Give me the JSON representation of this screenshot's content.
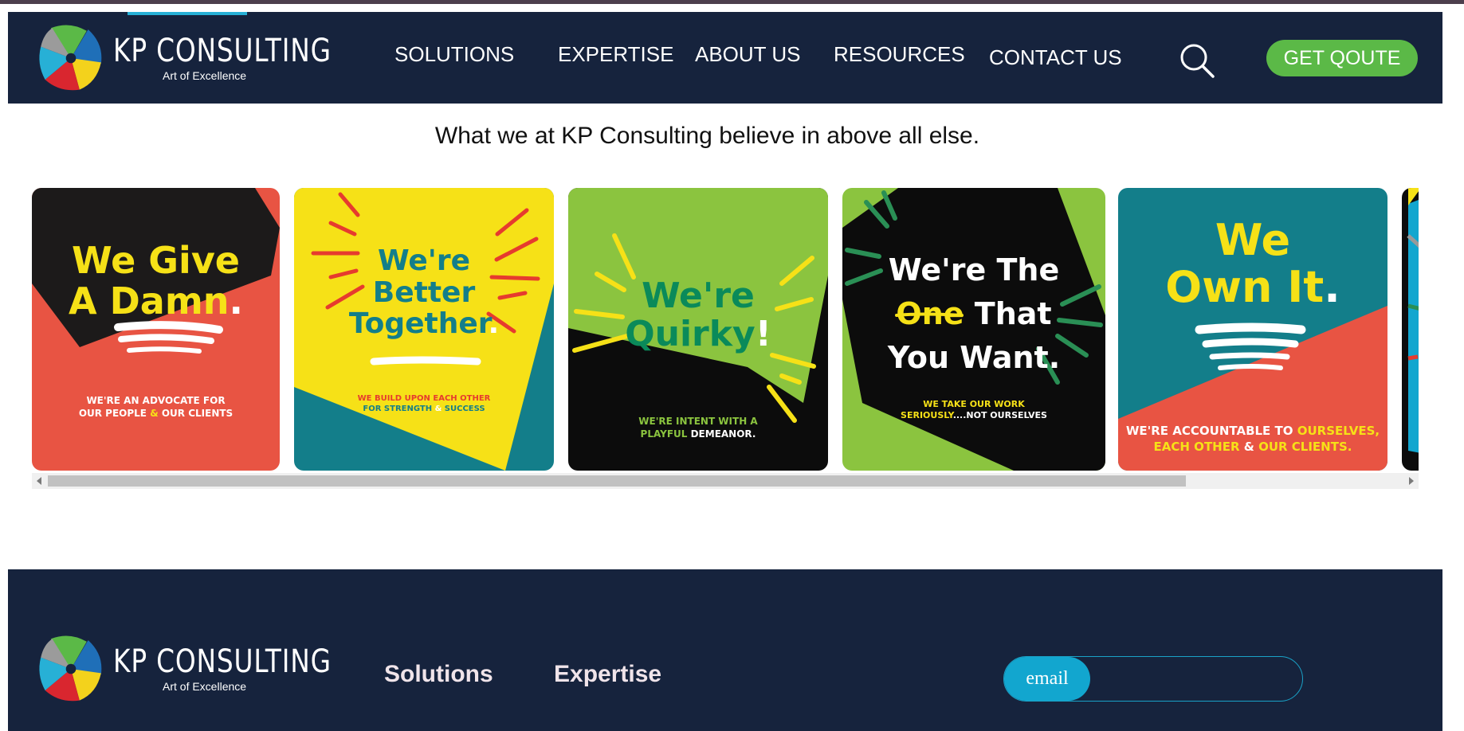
{
  "brand": {
    "name": "KP CONSULTING",
    "tagline": "Art of Excellence"
  },
  "nav": {
    "items": [
      {
        "label": "SOLUTIONS"
      },
      {
        "label": "EXPERTISE"
      },
      {
        "label": "ABOUT US"
      },
      {
        "label": "RESOURCES"
      },
      {
        "label": "CONTACT US"
      }
    ],
    "search_icon": "search-icon",
    "quote_label": "GET QOUTE"
  },
  "main": {
    "tagline": "What we at KP Consulting believe in above all else."
  },
  "values": [
    {
      "title_1": "We Give",
      "title_2": "A Damn",
      "title_end": ".",
      "sub_1": "WE'RE AN ADVOCATE FOR",
      "sub_2a": "OUR PEOPLE ",
      "sub_2b": "&",
      "sub_2c": " OUR CLIENTS"
    },
    {
      "title_1": "We're",
      "title_2": "Better",
      "title_3": "Together",
      "title_end": ".",
      "sub_1": "WE BUILD UPON EACH OTHER",
      "sub_2a": "FOR STRENGTH ",
      "sub_2b": "&",
      "sub_2c": " SUCCESS"
    },
    {
      "title_1": "We're",
      "title_2": "Quirky",
      "title_end": "!",
      "sub_1": "WE'RE INTENT WITH A",
      "sub_2a": "PLAYFUL ",
      "sub_2c": "DEMEANOR."
    },
    {
      "title_1": "We're The",
      "title_2a": "One",
      "title_2b": " That",
      "title_3": "You Want.",
      "sub_1": "WE TAKE OUR WORK",
      "sub_2a": "SERIOUSLY",
      "sub_2b": "....",
      "sub_2c": "NOT OURSELVES"
    },
    {
      "title_1": "We",
      "title_2": "Own It",
      "title_end": ".",
      "sub_1a": "WE'RE ACCOUNTABLE TO ",
      "sub_1b": "OURSELVES,",
      "sub_2a": "EACH OTHER ",
      "sub_2b": "&",
      "sub_2c": " OUR CLIENTS."
    }
  ],
  "footer": {
    "links": [
      {
        "label": "Solutions"
      },
      {
        "label": "Expertise"
      }
    ],
    "email_label": "email"
  },
  "colors": {
    "navy": "#16233d",
    "green": "#5bb947",
    "coral": "#e85443",
    "yellow": "#f6e117",
    "teal": "#137e8a",
    "lime": "#8bc43f",
    "cyan": "#12a6cf"
  }
}
